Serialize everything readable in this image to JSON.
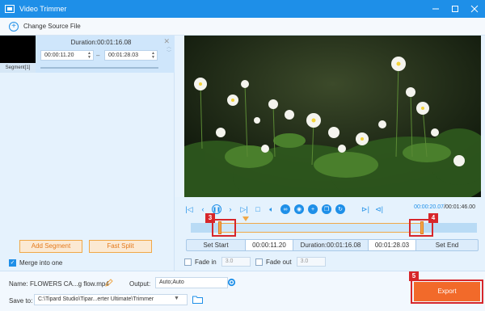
{
  "window": {
    "title": "Video Trimmer"
  },
  "source": {
    "change_label": "Change Source File"
  },
  "segment": {
    "duration": "Duration:00:01:16.08",
    "start": "00:00:11.20",
    "end": "00:01:28.03",
    "label": "Segment[1]"
  },
  "left_actions": {
    "add_segment": "Add Segment",
    "fast_split": "Fast Split",
    "merge_label": "Merge into one",
    "merge_checked": true
  },
  "player": {
    "current_time": "00:00:20.07",
    "total_time": "/00:01:46.00"
  },
  "trim": {
    "set_start": "Set Start",
    "start": "00:00:11.20",
    "duration": "Duration:00:01:16.08",
    "end": "00:01:28.03",
    "set_end": "Set End",
    "fade_in_label": "Fade in",
    "fade_in_value": "3.0",
    "fade_out_label": "Fade out",
    "fade_out_value": "3.0"
  },
  "annotations": {
    "c3": "3",
    "c4": "4",
    "c5": "5"
  },
  "output": {
    "name_label": "Name:",
    "name_value": "FLOWERS CA...g flow.mp4",
    "output_label": "Output:",
    "output_value": "Auto;Auto",
    "save_label": "Save to:",
    "save_value": "C:\\Tipard Studio\\Tipar...erter Ultimate\\Trimmer",
    "export_label": "Export"
  },
  "colors": {
    "accent": "#1e8fe8",
    "orange": "#f0a848",
    "export": "#f26a2a",
    "callout": "#d7262a"
  }
}
